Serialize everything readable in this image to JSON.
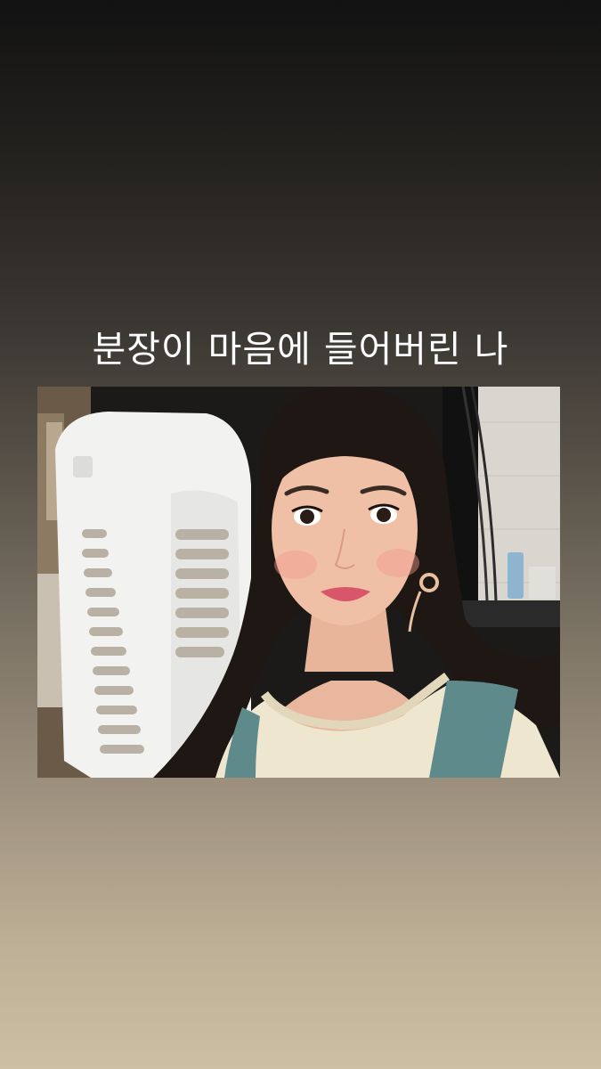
{
  "story": {
    "caption": "분장이 마음에 들어버린 나"
  },
  "photo": {
    "subject": "selfie-portrait",
    "colors": {
      "background_top": "#121212",
      "background_bottom": "#cdbfa4",
      "caption_text": "#ffffff"
    }
  }
}
